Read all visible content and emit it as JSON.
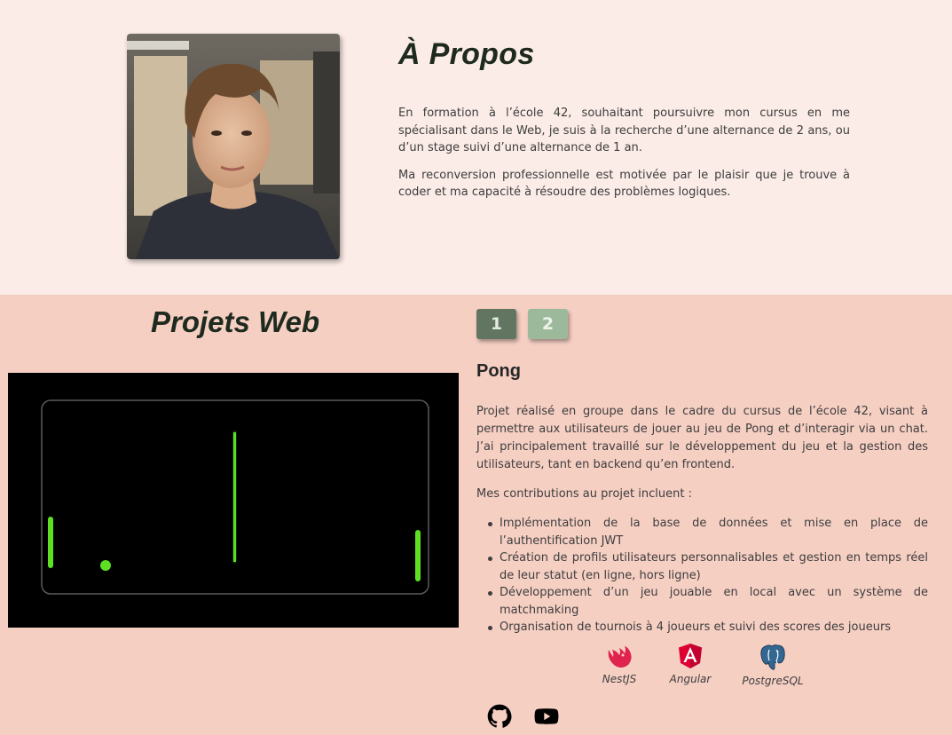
{
  "about": {
    "title": "À Propos",
    "paragraphs": [
      "En formation à l’école 42, souhaitant poursuivre mon cursus en me spécialisant dans le Web, je suis à la recherche d’une alternance de 2 ans, ou d’un stage suivi d’une alternance de 1 an.",
      "Ma reconversion professionnelle est motivée par le plaisir que je trouve à coder et ma capacité à résoudre des problèmes logiques."
    ]
  },
  "projects": {
    "title": "Projets Web",
    "tabs": [
      "1",
      "2"
    ],
    "active_tab": "1",
    "project": {
      "name": "Pong",
      "description": "Projet réalisé en groupe dans le cadre du cursus de l’école 42, visant à permettre aux utilisateurs de jouer au jeu de Pong et d’interagir via un chat. J’ai principalement travaillé sur le développement du jeu et la gestion des utilisateurs, tant en backend qu’en frontend.",
      "contributions_intro": "Mes contributions au projet incluent :",
      "contributions": [
        "Implémentation de la base de données et mise en place de l’authentification JWT",
        "Création de profils utilisateurs personnalisables et gestion en temps réel de leur statut (en ligne, hors ligne)",
        "Développement d’un jeu jouable en local avec un système de matchmaking",
        "Organisation de tournois à 4 joueurs et suivi des scores des joueurs"
      ],
      "technologies": [
        {
          "name": "NestJS",
          "icon": "nestjs-icon"
        },
        {
          "name": "Angular",
          "icon": "angular-icon"
        },
        {
          "name": "PostgreSQL",
          "icon": "postgresql-icon"
        }
      ]
    },
    "links": [
      {
        "icon": "github-icon"
      },
      {
        "icon": "youtube-icon"
      }
    ]
  },
  "colors": {
    "about_bg": "#fbece7",
    "projects_bg": "#f6cfc3",
    "tab_active": "#617560",
    "tab_inactive": "#9db99b",
    "pong_green": "#5ee022"
  }
}
